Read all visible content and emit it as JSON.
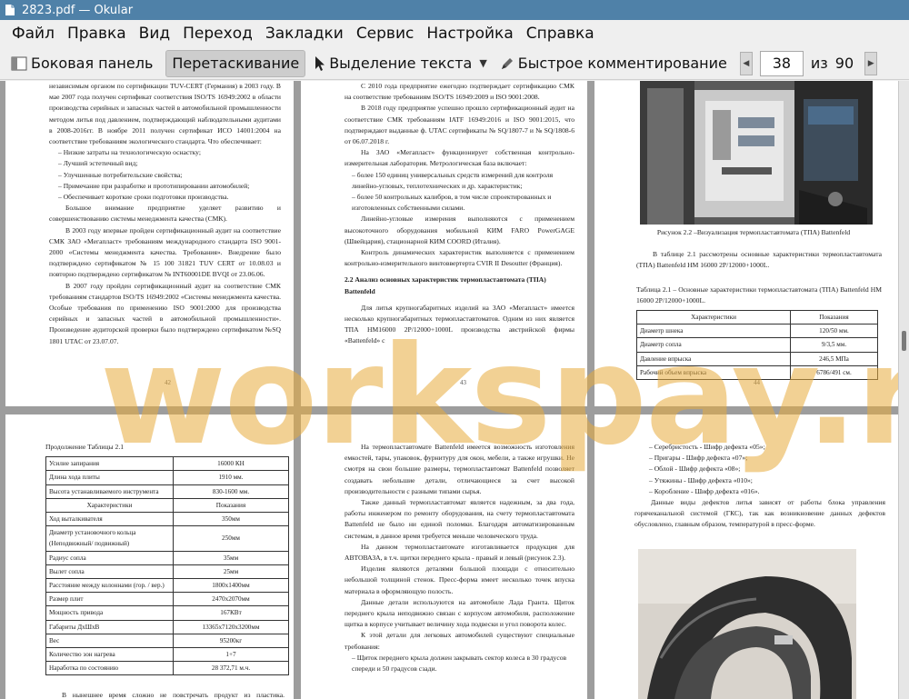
{
  "window": {
    "title": "2823.pdf  — Okular"
  },
  "menu": [
    "Файл",
    "Правка",
    "Вид",
    "Переход",
    "Закладки",
    "Сервис",
    "Настройка",
    "Справка"
  ],
  "toolbar": {
    "sidebar_label": "Боковая панель",
    "drag_label": "Перетаскивание",
    "select_label": "Выделение текста",
    "annotate_label": "Быстрое комментирование",
    "page_current": "38",
    "page_of": "из",
    "page_total": "90"
  },
  "watermark": "workspay.ru",
  "pages": {
    "p42": {
      "paras": [
        "независимым органом по сертификации TUV-CERT (Германия) в 2003 году. В мае 2007 года получен сертификат соответствия ISO/TS 16949:2002 в области производства серийных и запасных частей в автомобильной промышленности методом литья под давлением, подтверждающий наблюдательными аудитами в 2008-2016гг. В ноябре 2011 получен сертификат ИСО 14001:2004 на соответствие требованиям экологического стандарта. Что обеспечивает:"
      ],
      "list": [
        "Низкие затраты на технологическую оснастку;",
        "Лучший эстетичный вид;",
        "Улучшенные потребительские свойства;",
        "Примечание при разработке и прототипировании автомобилей;",
        "Обеспечивает короткие сроки подготовки производства."
      ],
      "paras2": [
        "Большое внимание предприятие уделяет развитию и совершенствованию системы менеджмента качества (СМК).",
        "В 2003 году впервые пройден сертификационный аудит на соответствие СМК ЗАО «Мегапласт» требованиям международного стандарта ISO 9001-2000 «Системы менеджмента качества. Требования». Внедрение было подтверждено сертификатом № 15 100 31821 TUV CERT от 10.08.03 и повторно подтверждено сертификатом № INT60001DE BVQI от 23.06.06.",
        "В 2007 году пройден сертификационный аудит на соответствие СМК требованиям стандартов ISO/TS 16949:2002 «Системы менеджмента качества. Особые требования по применению ISO 9001:2000 для производства серийных и запасных частей в автомобильной промышленности». Произведение аудиторской проверки было подтверждено сертификатом №SQ 1801 UTAC от 23.07.07."
      ],
      "num": "42"
    },
    "p43": {
      "paras": [
        "С 2010 года предприятие ежегодно подтверждает сертификацию СМК на соответствие требованиям ISO/TS 16949:2009 и ISO 9001:2008.",
        "В 2018 году предприятие успешно прошло сертификационный аудит на соответствие СМК требованиям IATF 16949:2016 и ISO 9001:2015, что подтверждают выданные ф. UTAC сертификаты № SQ/1807-7 и № SQ/1808-6 от 06.07.2018 г.",
        "На ЗАО «Мегапласт» функционирует собственная контрольно-измерительная лаборатория. Метрологическая база включает:"
      ],
      "list": [
        "более 150 единиц универсальных средств измерений для контроля линейно-угловых, теплотехнических и др. характеристик;",
        "более 50 контрольных калибров, в том числе спроектированных и изготовленных собственными силами."
      ],
      "paras2": [
        "Линейно-угловые измерения выполняются с применением высокоточного оборудования мобильной КИМ FARO PowerGAGE (Швейцария), стационарной КИМ COORD (Италия).",
        "Контроль динамических характеристик выполняется с применением контрольно-измерительного винтоввертерта CVIR II Desoutter (Франция)."
      ],
      "heading": "2.2 Анализ основных характеристик термопластавтомата (ТПА) Battenfeld",
      "paras3": [
        "Для литья крупногабаритных изделий на ЗАО «Мегапласт» имеется несколько крупногабаритных термопластавтоматов. Одним из них является ТПА HM16000 2Р/12000+1000L производства австрийской фирмы «Battenfeld» с"
      ],
      "num": "43"
    },
    "p44": {
      "caption": "Рисунок 2.2 –Визуализация термопластавтомата (ТПА) Battenfeld",
      "para": "В таблице 2.1 рассмотрены основные характеристики термопластавтомата (ТПА) Battenfeld HM 16000 2P/12000+1000L.",
      "table_title": "Таблица 2.1 – Основные характеристики термопластавтомата (ТПА) Battenfeld HM 16000 2P/12000+1000L.",
      "rows": [
        [
          "Характеристики",
          "Показания"
        ],
        [
          "Диаметр шнека",
          "120/50 мм."
        ],
        [
          "Диаметр сопла",
          "9/3,5 мм."
        ],
        [
          "Давление впрыска",
          "246,5 МПа"
        ],
        [
          "Рабочий объем впрыска",
          "6786/491 см."
        ]
      ],
      "num": "44"
    },
    "p45": {
      "table_title": "Продолжение Таблицы 2.1",
      "rows": [
        [
          "Усилие запирания",
          "16000 КН"
        ],
        [
          "Длина хода плиты",
          "1910 мм."
        ],
        [
          "Высота устанавливаемого инструмента",
          "830-1600 мм."
        ],
        [
          "Характеристики",
          "Показания"
        ],
        [
          "Ход выталкивателя",
          "350мм"
        ],
        [
          "Диаметр установочного кольца (Неподвижный/ подвижный)",
          "250мм"
        ],
        [
          "Радиус сопла",
          "35мм"
        ],
        [
          "Вылет сопла",
          "25мм"
        ],
        [
          "Расстояние между колоннами (гор. / вер.)",
          "1800х1400мм"
        ],
        [
          "Размер плит",
          "2470х2070мм"
        ],
        [
          "Мощность привода",
          "167КВт"
        ],
        [
          "Габариты ДхШхВ",
          "13365х7120х3200мм"
        ],
        [
          "Вес",
          "95200кг"
        ],
        [
          "Количество зон нагрева",
          "1+7"
        ],
        [
          "Наработка по состоянию",
          "28 372,71 м.ч."
        ]
      ],
      "para": "В нынешнее время сложно не повстречать продукт из пластика. Термопластавтомат Battenfeld является одним из станков, который способен"
    },
    "p46": {
      "paras": [
        "На термопластавтомате Battenfeld имеется возможность изготовления емкостей, тары, упаковок, фурнитуру для окон, мебели, а также игрушки. Не смотря на свои большие размеры, термопластавтомат Battenfeld позволяет создавать небольшие детали, отличающиеся за счет высокой производительности с разными типами сырья.",
        "Также данный термопластавтомат является надежным, за два года, работы инженером по ремонту оборудования, на счету термопластавтомата Battenfeld не было ни единой поломки. Благодаря автоматизированным системам, в данное время требуется меньше человеческого труда.",
        "На данном термопластавтомате изготавливается продукция для АВТОВАЗА, в т.ч. щитки переднего крыла - правый и левый (рисунок 2.3).",
        "Изделия являются деталями большой площади с относительно небольшой толщиной стенок. Пресс-форма имеет несколько точек впуска материала в оформляющую полость.",
        "Данные детали используются на автомобиле Лада Гранта. Щиток переднего крыла неподвижно связан с корпусом автомобиля, расположение щитка в корпусе учитывает величину хода подвески и угол поворота колес.",
        "К этой детали для легковых автомобилей существуют специальные требования:"
      ],
      "list": [
        "Щиток переднего крыла должен закрывать сектор колеса в 30 градусов спереди и 50 градусов сзади."
      ]
    },
    "p47": {
      "list": [
        "Серебристость - Шифр дефекта «05»;",
        "Пригары - Шифр дефекта «07»;",
        "Облой - Шифр дефекта «08»;",
        "Утяжины - Шифр дефекта «010»;",
        "Коробление - Шифр дефекта «016»."
      ],
      "para": "Данные виды дефектов литья зависят от работы блока управления горячеканальной системой (ГКС), так как возникновение данных дефектов обусловлено, главным образом, температурой в пресс-форме."
    }
  }
}
